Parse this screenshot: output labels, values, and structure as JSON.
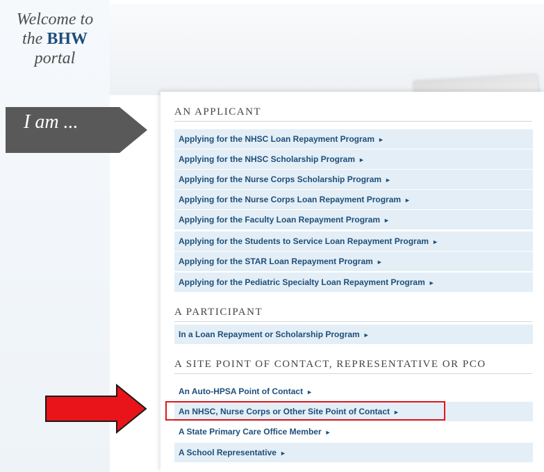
{
  "welcome": {
    "line1": "Welcome to",
    "line2_prefix": "the",
    "brand": "BHW",
    "line3": "portal"
  },
  "iam_label": "I am ...",
  "sections": {
    "applicant": {
      "title": "AN APPLICANT",
      "links": [
        "Applying for the NHSC Loan Repayment Program",
        "Applying for the NHSC Scholarship Program",
        "Applying for the Nurse Corps Scholarship Program",
        "Applying for the Nurse Corps Loan Repayment Program",
        "Applying for the Faculty Loan Repayment Program",
        "Applying for the Students to Service Loan Repayment Program",
        "Applying for the STAR Loan Repayment Program",
        "Applying for the Pediatric Specialty Loan Repayment Program"
      ]
    },
    "participant": {
      "title": "A PARTICIPANT",
      "links": [
        "In a Loan Repayment or Scholarship Program"
      ]
    },
    "site": {
      "title": "A SITE POINT OF CONTACT, REPRESENTATIVE OR PCO",
      "links": [
        "An Auto-HPSA Point of Contact",
        "An NHSC, Nurse Corps or Other Site Point of Contact",
        "A State Primary Care Office Member",
        "A School Representative"
      ]
    }
  },
  "arrow_glyph": "►",
  "colors": {
    "link": "#1d4f7a",
    "row_bg": "#e4eef6",
    "highlight": "#e0161c",
    "brand": "#1f4e79"
  }
}
